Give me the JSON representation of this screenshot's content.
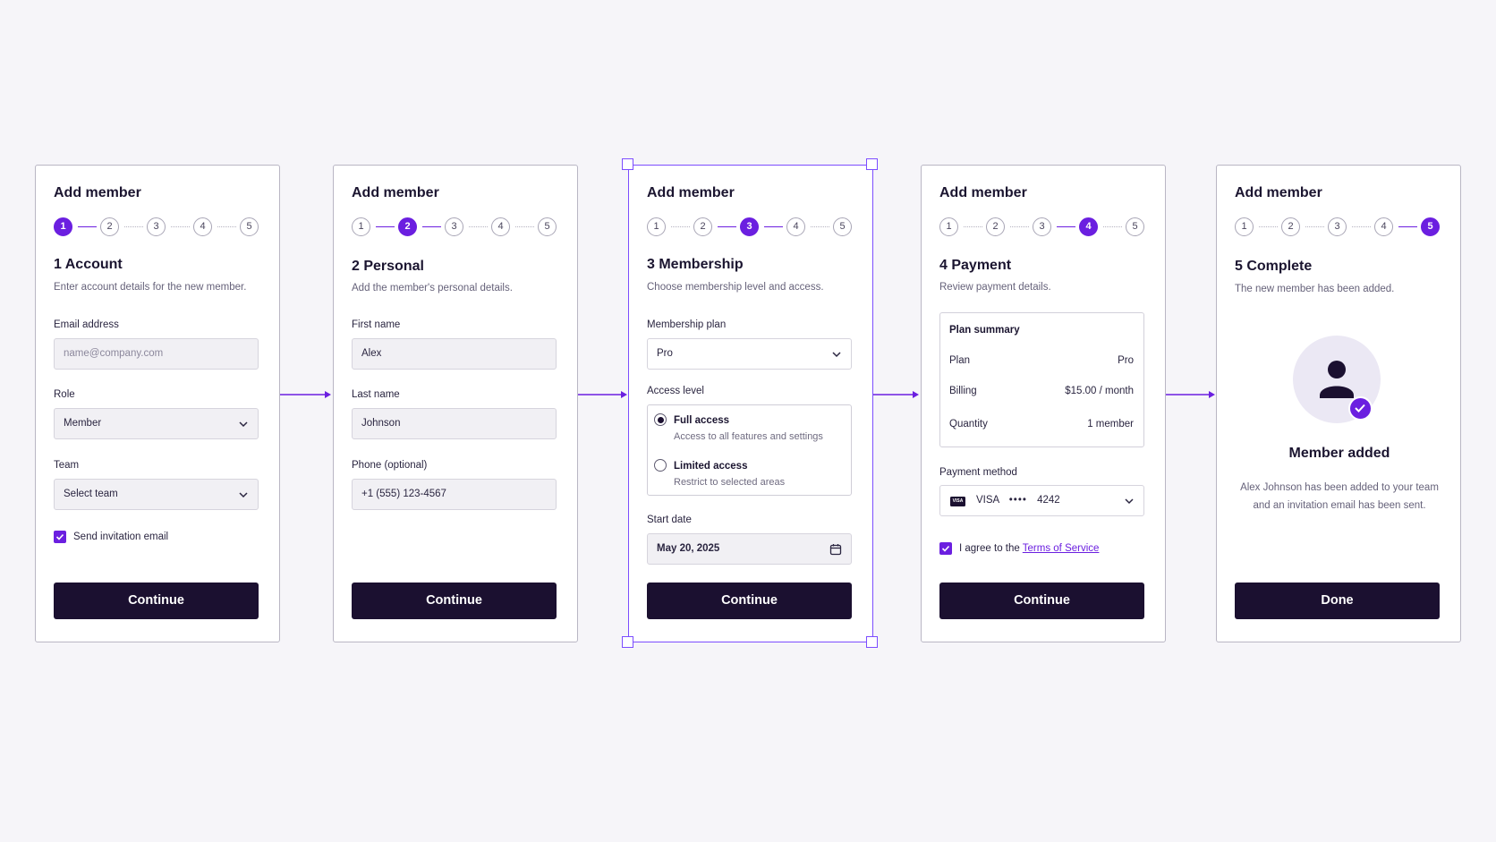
{
  "cards": [
    {
      "title": "Add member",
      "steps": [
        "1",
        "2",
        "3",
        "4",
        "5"
      ],
      "section_title": "1 Account",
      "section_sub": "Enter account details for the new member.",
      "email_label": "Email address",
      "email_placeholder": "name@company.com",
      "role_label": "Role",
      "role_value": "Member",
      "team_label": "Team",
      "team_value": "Select team",
      "invite_label": "Send invitation email",
      "button": "Continue"
    },
    {
      "title": "Add member",
      "steps": [
        "1",
        "2",
        "3",
        "4",
        "5"
      ],
      "section_title": "2 Personal",
      "section_sub": "Add the member's personal details.",
      "first_label": "First name",
      "first_value": "Alex",
      "last_label": "Last name",
      "last_value": "Johnson",
      "phone_label": "Phone (optional)",
      "phone_value": "+1 (555) 123-4567",
      "button": "Continue"
    },
    {
      "title": "Add member",
      "steps": [
        "1",
        "2",
        "3",
        "4",
        "5"
      ],
      "section_title": "3 Membership",
      "section_sub": "Choose membership level and access.",
      "plan_label": "Membership plan",
      "plan_value": "Pro",
      "access_label": "Access level",
      "full_title": "Full access",
      "full_desc": "Access to all features and settings",
      "limited_title": "Limited access",
      "limited_desc": "Restrict to selected areas",
      "date_label": "Start date",
      "date_value": "May 20, 2025",
      "button": "Continue"
    },
    {
      "title": "Add member",
      "steps": [
        "1",
        "2",
        "3",
        "4",
        "5"
      ],
      "section_title": "4 Payment",
      "section_sub": "Review payment details.",
      "summary_title": "Plan summary",
      "plan_key": "Plan",
      "plan_val": "Pro",
      "billing_key": "Billing",
      "billing_val": "$15.00 / month",
      "qty_key": "Quantity",
      "qty_val": "1 member",
      "method_label": "Payment method",
      "visa_badge": "VISA",
      "card_brand": "VISA",
      "card_dots": "••••",
      "card_last4": "4242",
      "agree_prefix": "I agree to the",
      "agree_link": "Terms of Service",
      "button": "Continue"
    },
    {
      "title": "Add member",
      "steps": [
        "1",
        "2",
        "3",
        "4",
        "5"
      ],
      "section_title": "5 Complete",
      "section_sub": "The new member has been added.",
      "done_title": "Member added",
      "done_text": "Alex Johnson has been added to your team and an invitation email has been sent.",
      "button": "Done"
    }
  ],
  "colors": {
    "accent": "#6b1fe0",
    "button_dark": "#1b1030",
    "selection": "#7c4dff"
  }
}
